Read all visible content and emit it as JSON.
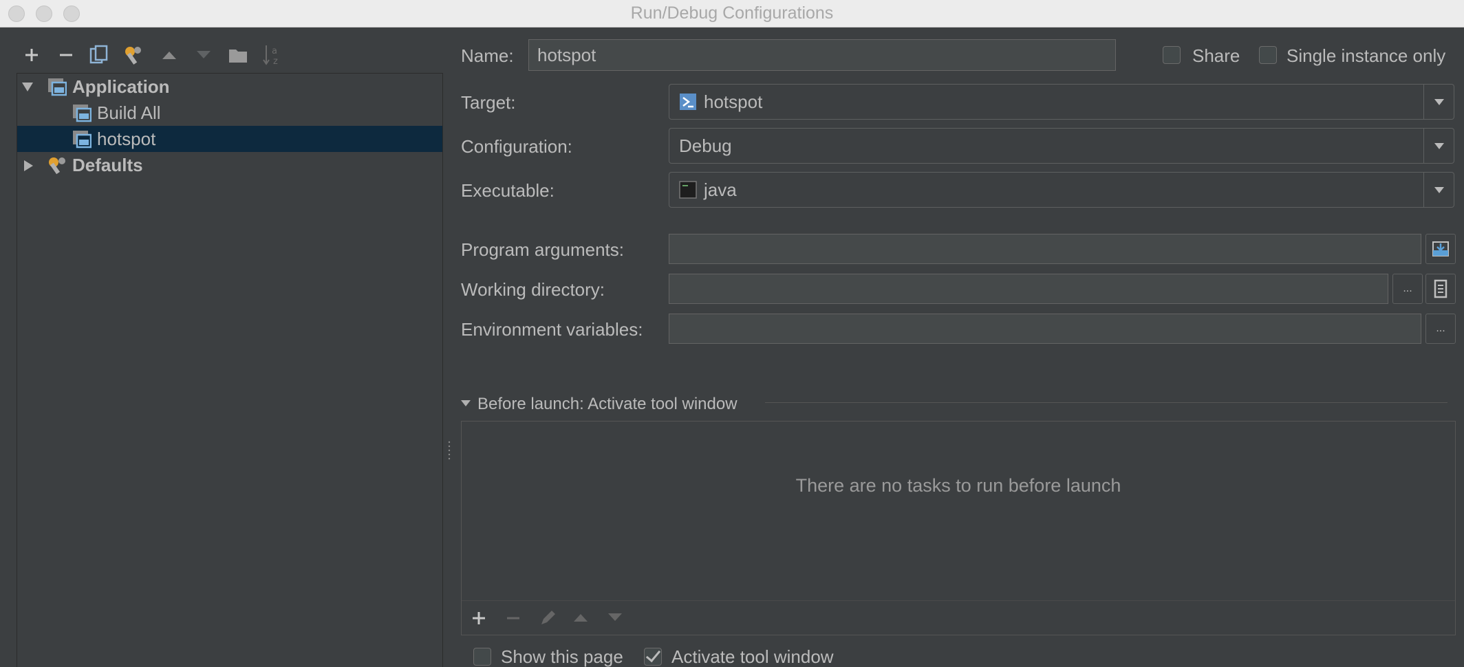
{
  "window": {
    "title": "Run/Debug Configurations"
  },
  "tree": {
    "application": "Application",
    "build_all": "Build All",
    "hotspot": "hotspot",
    "defaults": "Defaults"
  },
  "form": {
    "name_label": "Name:",
    "name_value": "hotspot",
    "share_label": "Share",
    "single_instance_label": "Single instance only",
    "target_label": "Target:",
    "target_value": "hotspot",
    "configuration_label": "Configuration:",
    "configuration_value": "Debug",
    "executable_label": "Executable:",
    "executable_value": "java",
    "program_args_label": "Program arguments:",
    "working_dir_label": "Working directory:",
    "env_vars_label": "Environment variables:",
    "ellipsis": "..."
  },
  "before_launch": {
    "header": "Before launch: Activate tool window",
    "empty_message": "There are no tasks to run before launch",
    "show_page_label": "Show this page",
    "activate_tool_window_label": "Activate tool window"
  },
  "colors": {
    "background": "#3c3f41",
    "selection": "#0d293e",
    "field_bg": "#45494a",
    "text": "#bbbbbb"
  }
}
